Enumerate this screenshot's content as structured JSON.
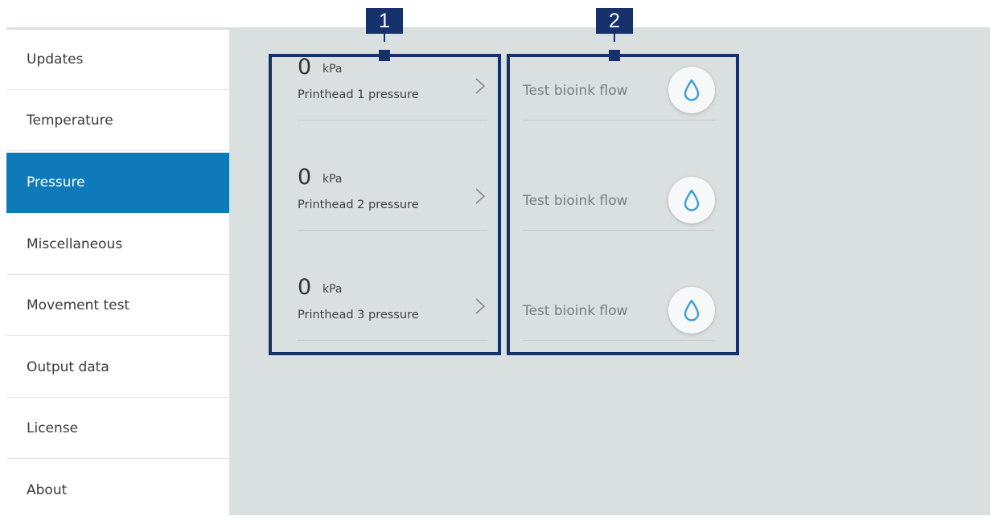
{
  "sidebar": {
    "items": [
      {
        "label": "Updates",
        "active": false
      },
      {
        "label": "Temperature",
        "active": false
      },
      {
        "label": "Pressure",
        "active": true
      },
      {
        "label": "Miscellaneous",
        "active": false
      },
      {
        "label": "Movement test",
        "active": false
      },
      {
        "label": "Output data",
        "active": false
      },
      {
        "label": "License",
        "active": false
      },
      {
        "label": "About",
        "active": false
      }
    ]
  },
  "callouts": [
    "1",
    "2"
  ],
  "pressure": {
    "rows": [
      {
        "value": "0",
        "unit": "kPa",
        "label": "Printhead 1 pressure"
      },
      {
        "value": "0",
        "unit": "kPa",
        "label": "Printhead 2 pressure"
      },
      {
        "value": "0",
        "unit": "kPa",
        "label": "Printhead 3 pressure"
      }
    ]
  },
  "flow": {
    "rows": [
      {
        "label": "Test bioink flow",
        "icon": "droplet-icon"
      },
      {
        "label": "Test bioink flow",
        "icon": "droplet-icon"
      },
      {
        "label": "Test bioink flow",
        "icon": "droplet-icon"
      }
    ]
  },
  "colors": {
    "accent": "#0f7ab8",
    "callout": "#16306b",
    "background": "#dadfe0",
    "droplet": "#3a9fd8"
  }
}
